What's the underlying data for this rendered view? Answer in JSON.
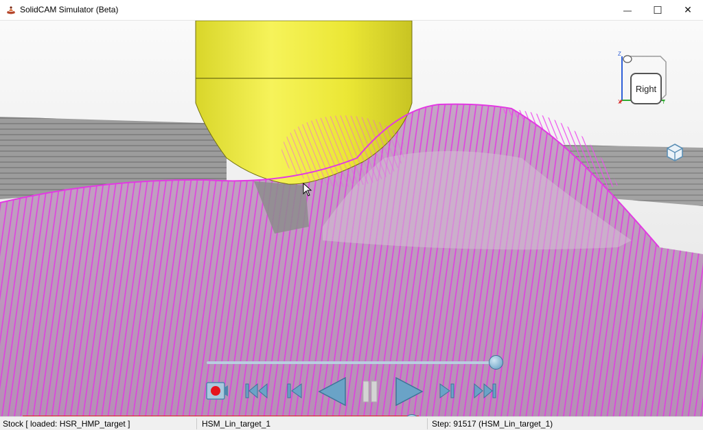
{
  "window": {
    "title": "SolidCAM Simulator (Beta)",
    "minimize_glyph": "—",
    "maximize_glyph": "☐",
    "close_glyph": "✕"
  },
  "viewcube": {
    "face_label": "Right",
    "axis_z": "Z",
    "axis_y": "Y",
    "axis_x": "X"
  },
  "colors": {
    "tool_yellow": "#f3f03a",
    "toolpath_magenta": "#e63ee6",
    "stock_grey": "#8a8a8a",
    "progress_red": "#e8212a",
    "control_blue": "#5b98bf"
  },
  "playback": {
    "speed_level": 0.97,
    "progress_fraction": 0.59,
    "buttons": [
      "record-button",
      "rewind-to-start-button",
      "previous-step-button",
      "play-reverse-button",
      "pause-button",
      "play-button",
      "next-step-button",
      "fast-forward-to-end-button"
    ]
  },
  "status": {
    "stock": "Stock [ loaded:  HSR_HMP_target ]",
    "operation": "HSM_Lin_target_1",
    "step": "Step: 91517 (HSM_Lin_target_1)"
  }
}
